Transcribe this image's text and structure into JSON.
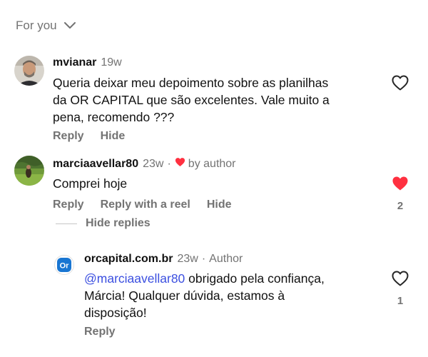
{
  "header": {
    "sort_label": "For you"
  },
  "comments": [
    {
      "username": "mvianar",
      "time": "19w",
      "text_lines": [
        "Queria deixar meu depoimento sobre as planilhas",
        "da OR CAPITAL que são excelentes. Vale muito a",
        "pena, recomendo ???"
      ],
      "actions": [
        "Reply",
        "Hide"
      ],
      "liked": false
    },
    {
      "username": "marciaavellar80",
      "time": "23w",
      "by_author_label": "by author",
      "text": "Comprei hoje",
      "actions": [
        "Reply",
        "Reply with a reel",
        "Hide"
      ],
      "liked": true,
      "like_count": "2",
      "hide_replies_label": "Hide replies",
      "replies": [
        {
          "username": "orcapital.com.br",
          "time": "23w",
          "author_label": "Author",
          "avatar_text": "Or",
          "mention": "@marciaavellar80",
          "text_lines": [
            " obrigado pela confiança,",
            "Márcia! Qualquer dúvida, estamos à",
            "disposição!"
          ],
          "actions": [
            "Reply"
          ],
          "liked": false,
          "like_count": "1"
        }
      ]
    }
  ],
  "colors": {
    "heart_red": "#ff3040",
    "mention_blue": "#3b4fe0",
    "secondary_text": "#737373",
    "brand_blue": "#1976d2"
  }
}
